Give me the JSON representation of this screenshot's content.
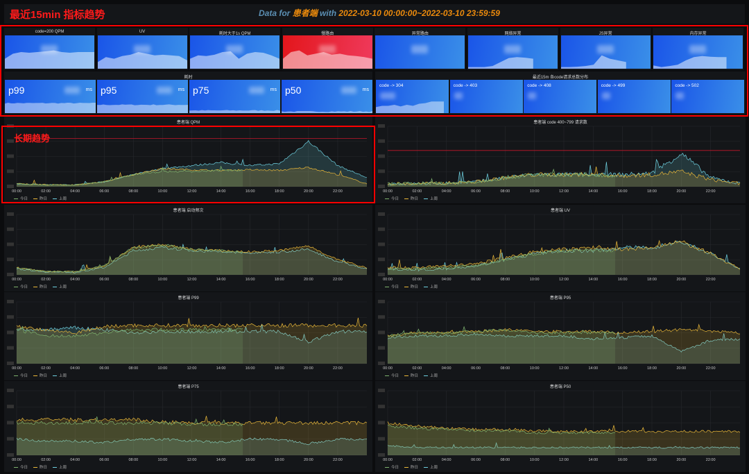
{
  "header": {
    "title": "最近15min 指标趋势",
    "prefix": "Data for ",
    "app": "患者端",
    "mid": " with ",
    "range": "2022-03-10 00:00:00~2022-03-10 23:59:59"
  },
  "long_term_label": "长期趋势",
  "stats": [
    {
      "title": "code=200 QPM",
      "color": "blue",
      "spark": [
        0.3,
        0.45,
        0.5,
        0.48,
        0.5,
        0.52,
        0.55,
        0.5,
        0.48,
        0.5,
        0.5,
        0.5
      ]
    },
    {
      "title": "UV",
      "color": "blue",
      "spark": [
        0.2,
        0.35,
        0.3,
        0.38,
        0.42,
        0.5,
        0.45,
        0.4,
        0.42,
        0.4,
        0.38,
        0.25
      ]
    },
    {
      "title": "耗时大于1s QPM",
      "color": "blue",
      "spark": [
        0.3,
        0.4,
        0.38,
        0.42,
        0.5,
        0.52,
        0.3,
        0.45,
        0.5,
        0.48,
        0.4,
        0.3
      ]
    },
    {
      "title": "慢路由",
      "color": "red",
      "spark": [
        0.3,
        0.5,
        0.55,
        0.4,
        0.45,
        0.5,
        0.42,
        0.45,
        0.4,
        0.38,
        0.35,
        0.3
      ]
    },
    {
      "title": "异常路由",
      "color": "blue",
      "spark": []
    },
    {
      "title": "网络异常",
      "color": "blue",
      "spark": [
        0.05,
        0.05,
        0.05,
        0.08,
        0.2,
        0.32,
        0.35,
        0.33,
        0.3,
        0,
        0,
        0
      ]
    },
    {
      "title": "JS异常",
      "color": "blue",
      "spark": [
        0.05,
        0.05,
        0.06,
        0.08,
        0.12,
        0.4,
        0.3,
        0.25,
        0.2,
        0,
        0,
        0
      ]
    },
    {
      "title": "内存异常",
      "color": "blue",
      "spark": [
        0.1,
        0.05,
        0.08,
        0.12,
        0.25,
        0.35,
        0.38,
        0.36,
        0.35,
        0.35,
        0,
        0
      ]
    }
  ],
  "latency": {
    "title": "耗时",
    "unit": "ms",
    "items": [
      {
        "label": "p99",
        "level": 0.3
      },
      {
        "label": "p95",
        "level": 0.25
      },
      {
        "label": "p75",
        "level": 0.08
      },
      {
        "label": "p50",
        "level": 0.05
      }
    ]
  },
  "codes": {
    "title": "最近15m 各code请求总数分布",
    "items": [
      {
        "label": "code -> 304"
      },
      {
        "label": "code -> 403"
      },
      {
        "label": "code -> 408"
      },
      {
        "label": "code -> 499"
      },
      {
        "label": "code -> 502"
      }
    ]
  },
  "legend": [
    "今日",
    "昨日",
    "上周"
  ],
  "series_colors": [
    "#7eb26d",
    "#eab839",
    "#6ed0e0"
  ],
  "x_ticks": [
    "00:00",
    "02:00",
    "04:00",
    "06:00",
    "08:00",
    "10:00",
    "12:00",
    "14:00",
    "16:00",
    "18:00",
    "20:00",
    "22:00"
  ],
  "chart_data": [
    {
      "type": "line",
      "title": "患者端 QPM",
      "threshold": 0.8,
      "today_end": 15.5,
      "profile": [
        [
          0.05,
          0.03,
          0.03,
          0.08,
          0.2,
          0.25,
          0.25,
          0.27,
          0.27,
          0.3,
          0.35,
          0.25,
          0.05
        ],
        [
          0.05,
          0.03,
          0.03,
          0.08,
          0.2,
          0.3,
          0.28,
          0.27,
          0.28,
          0.27,
          0.32,
          0.2,
          0.05
        ],
        [
          0.05,
          0.03,
          0.03,
          0.08,
          0.2,
          0.3,
          0.35,
          0.4,
          0.35,
          0.38,
          0.75,
          0.35,
          0.15
        ]
      ],
      "noise": 0.04
    },
    {
      "type": "line",
      "title": "患者端 code 400~799 请求数",
      "threshold": 0.6,
      "today_end": 15.5,
      "profile": [
        [
          0.05,
          0.05,
          0.06,
          0.08,
          0.15,
          0.2,
          0.2,
          0.2,
          0.18,
          0.2,
          0.25,
          0.12,
          0.05
        ],
        [
          0.05,
          0.05,
          0.06,
          0.08,
          0.15,
          0.2,
          0.2,
          0.2,
          0.18,
          0.2,
          0.25,
          0.12,
          0.05
        ],
        [
          0.05,
          0.05,
          0.06,
          0.08,
          0.15,
          0.2,
          0.2,
          0.2,
          0.2,
          0.22,
          0.55,
          0.15,
          0.05
        ]
      ],
      "noise": 0.12
    },
    {
      "type": "line",
      "title": "患者端 启动频次",
      "today_end": 15.5,
      "profile": [
        [
          0.12,
          0.06,
          0.05,
          0.15,
          0.45,
          0.5,
          0.42,
          0.4,
          0.38,
          0.4,
          0.45,
          0.25,
          0.12
        ],
        [
          0.12,
          0.06,
          0.05,
          0.15,
          0.45,
          0.5,
          0.42,
          0.4,
          0.38,
          0.4,
          0.48,
          0.25,
          0.12
        ],
        [
          0.1,
          0.05,
          0.04,
          0.12,
          0.4,
          0.45,
          0.4,
          0.38,
          0.36,
          0.38,
          0.42,
          0.22,
          0.1
        ]
      ],
      "noise": 0.05
    },
    {
      "type": "line",
      "title": "患者端 UV",
      "today_end": 15.5,
      "profile": [
        [
          0.1,
          0.1,
          0.12,
          0.15,
          0.25,
          0.35,
          0.4,
          0.4,
          0.4,
          0.4,
          0.5,
          0.3,
          0.1
        ],
        [
          0.12,
          0.12,
          0.15,
          0.18,
          0.28,
          0.38,
          0.42,
          0.45,
          0.42,
          0.45,
          0.55,
          0.35,
          0.1
        ],
        [
          0.1,
          0.08,
          0.1,
          0.15,
          0.25,
          0.35,
          0.4,
          0.4,
          0.45,
          0.45,
          0.55,
          0.35,
          0.1
        ]
      ],
      "noise": 0.08
    },
    {
      "type": "line",
      "title": "患者端 P99",
      "today_end": 15.5,
      "profile": [
        [
          0.55,
          0.45,
          0.45,
          0.5,
          0.55,
          0.55,
          0.55,
          0.55,
          0.55,
          0.55,
          0.55,
          0.55,
          0.55
        ],
        [
          0.6,
          0.55,
          0.5,
          0.6,
          0.62,
          0.62,
          0.62,
          0.62,
          0.62,
          0.62,
          0.62,
          0.62,
          0.62
        ],
        [
          0.55,
          0.55,
          0.58,
          0.55,
          0.5,
          0.52,
          0.52,
          0.52,
          0.52,
          0.52,
          0.35,
          0.52,
          0.52
        ]
      ],
      "noise": 0.06
    },
    {
      "type": "line",
      "title": "患者端 P95",
      "today_end": 15.5,
      "profile": [
        [
          0.45,
          0.5,
          0.5,
          0.52,
          0.55,
          0.5,
          0.5,
          0.5,
          0.5,
          0.5,
          0.5,
          0.5,
          0.5
        ],
        [
          0.45,
          0.5,
          0.5,
          0.52,
          0.55,
          0.52,
          0.52,
          0.52,
          0.5,
          0.52,
          0.55,
          0.52,
          0.5
        ],
        [
          0.42,
          0.45,
          0.45,
          0.48,
          0.45,
          0.45,
          0.45,
          0.4,
          0.42,
          0.45,
          0.2,
          0.38,
          0.4
        ]
      ],
      "noise": 0.05
    },
    {
      "type": "line",
      "title": "患者端 P75",
      "today_end": 15.5,
      "profile": [
        [
          0.5,
          0.5,
          0.5,
          0.5,
          0.5,
          0.5,
          0.48,
          0.48,
          0.48,
          0.48,
          0.48,
          0.48,
          0.48
        ],
        [
          0.55,
          0.55,
          0.55,
          0.55,
          0.55,
          0.52,
          0.5,
          0.5,
          0.5,
          0.5,
          0.5,
          0.5,
          0.5
        ],
        [
          0.25,
          0.22,
          0.22,
          0.2,
          0.25,
          0.25,
          0.22,
          0.2,
          0.25,
          0.25,
          0.18,
          0.25,
          0.25
        ]
      ],
      "noise": 0.06
    },
    {
      "type": "line",
      "title": "患者端 P50",
      "today_end": 15.5,
      "profile": [
        [
          0.45,
          0.42,
          0.4,
          0.38,
          0.38,
          0.35,
          0.35,
          0.35,
          0.35,
          0.35,
          0.35,
          0.35,
          0.35
        ],
        [
          0.5,
          0.45,
          0.42,
          0.4,
          0.4,
          0.38,
          0.37,
          0.37,
          0.37,
          0.37,
          0.37,
          0.37,
          0.37
        ],
        [
          0.15,
          0.12,
          0.12,
          0.12,
          0.12,
          0.12,
          0.12,
          0.12,
          0.12,
          0.12,
          0.12,
          0.12,
          0.12
        ]
      ],
      "noise": 0.05
    }
  ]
}
